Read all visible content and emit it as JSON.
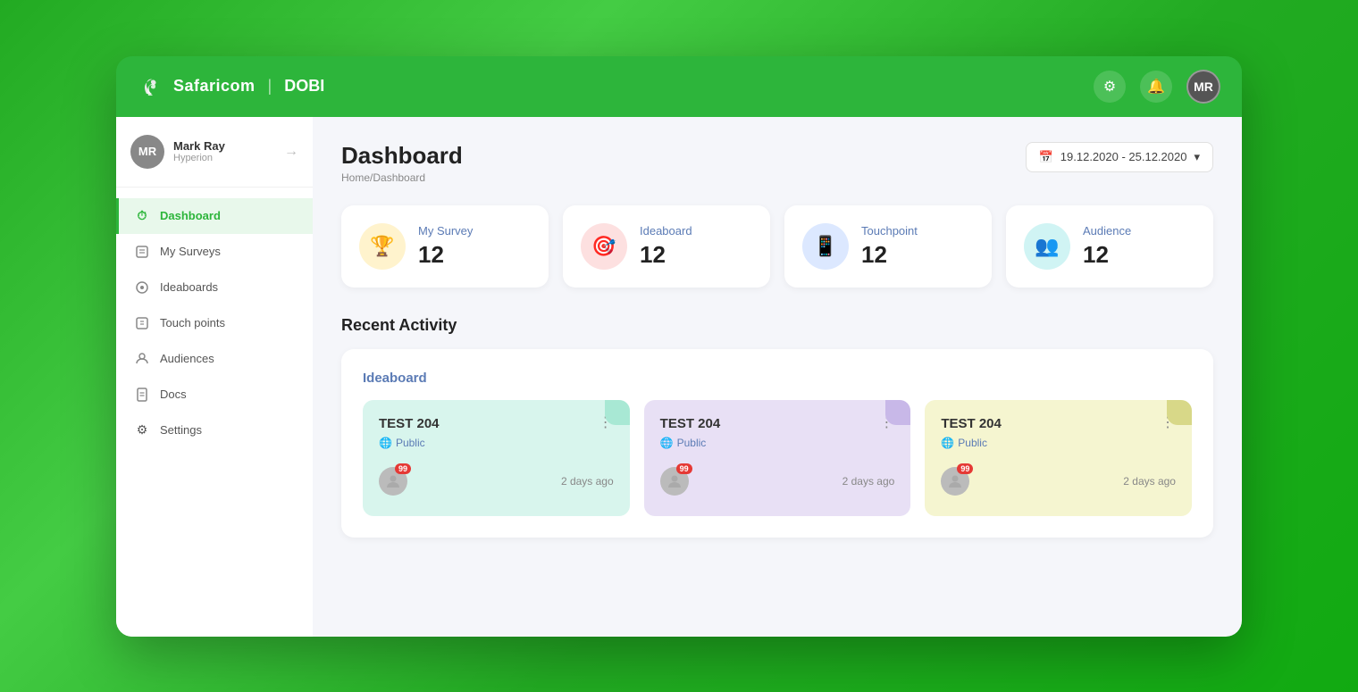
{
  "app": {
    "logo_brand": "Safaricom",
    "logo_divider": "|",
    "logo_sub": "DOBI"
  },
  "header": {
    "settings_icon": "⚙",
    "bell_icon": "🔔",
    "avatar_initials": "MR"
  },
  "sidebar": {
    "user": {
      "name": "Mark Ray",
      "role": "Hyperion",
      "avatar_initials": "MR"
    },
    "logout_icon": "→",
    "items": [
      {
        "id": "dashboard",
        "label": "Dashboard",
        "icon": "⏱",
        "active": true
      },
      {
        "id": "my-surveys",
        "label": "My Surveys",
        "icon": "📋",
        "active": false
      },
      {
        "id": "ideaboards",
        "label": "Ideaboards",
        "icon": "💡",
        "active": false
      },
      {
        "id": "touchpoints",
        "label": "Touch points",
        "icon": "📌",
        "active": false
      },
      {
        "id": "audiences",
        "label": "Audiences",
        "icon": "👤",
        "active": false
      },
      {
        "id": "docs",
        "label": "Docs",
        "icon": "📄",
        "active": false
      },
      {
        "id": "settings",
        "label": "Settings",
        "icon": "⚙",
        "active": false
      }
    ]
  },
  "content": {
    "page_title": "Dashboard",
    "breadcrumb_home": "Home",
    "breadcrumb_sep": "/",
    "breadcrumb_current": "Dashboard",
    "date_range": "19.12.2020 - 25.12.2020",
    "stats": [
      {
        "id": "my-survey",
        "label": "My Survey",
        "value": "12",
        "color": "yellow",
        "icon": "🏆"
      },
      {
        "id": "ideaboard",
        "label": "Ideaboard",
        "value": "12",
        "color": "pink",
        "icon": "🎯"
      },
      {
        "id": "touchpoint",
        "label": "Touchpoint",
        "value": "12",
        "color": "blue",
        "icon": "📱"
      },
      {
        "id": "audience",
        "label": "Audience",
        "value": "12",
        "color": "teal",
        "icon": "👥"
      }
    ],
    "recent_activity_title": "Recent Activity",
    "ideaboard_section_title": "Ideaboard",
    "cards": [
      {
        "id": "card1",
        "title": "TEST 204",
        "visibility": "Public",
        "time": "2 days ago",
        "badge": "99",
        "color": "green"
      },
      {
        "id": "card2",
        "title": "TEST 204",
        "visibility": "Public",
        "time": "2 days ago",
        "badge": "99",
        "color": "purple"
      },
      {
        "id": "card3",
        "title": "TEST 204",
        "visibility": "Public",
        "time": "2 days ago",
        "badge": "99",
        "color": "yellow"
      }
    ]
  }
}
